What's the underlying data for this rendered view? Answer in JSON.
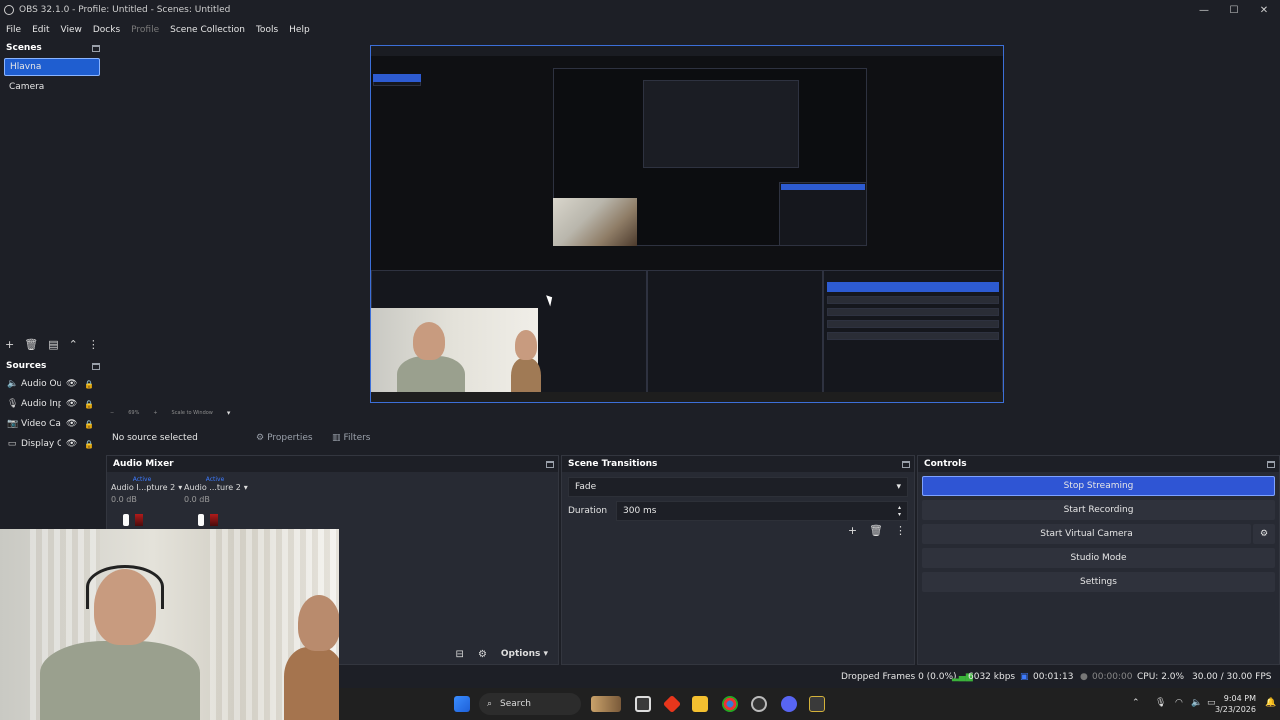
{
  "window": {
    "title": "OBS 32.1.0 - Profile: Untitled - Scenes: Untitled",
    "minimize_glyph": "—",
    "maximize_glyph": "☐",
    "close_glyph": "✕"
  },
  "menu": [
    "File",
    "Edit",
    "View",
    "Docks",
    "Profile",
    "Scene Collection",
    "Tools",
    "Help"
  ],
  "scenes": {
    "title": "Scenes",
    "items": [
      "Hlavna",
      "Camera"
    ],
    "selected": "Hlavna"
  },
  "sources": {
    "title": "Sources",
    "items": [
      {
        "label": "Audio Out",
        "icon": "speaker-icon"
      },
      {
        "label": "Audio Inp",
        "icon": "microphone-icon"
      },
      {
        "label": "Video Cap",
        "icon": "camera-icon"
      },
      {
        "label": "Display Ca",
        "icon": "monitor-icon"
      }
    ]
  },
  "context": {
    "no_source": "No source selected",
    "properties": "Properties",
    "filters": "Filters"
  },
  "preview_bottom": {
    "zoom": "69%",
    "scale": "Scale to Window"
  },
  "audio_mixer": {
    "title": "Audio Mixer",
    "tracks": [
      {
        "name": "Audio I...pture 2",
        "status": "Active",
        "db": "0.0 dB"
      },
      {
        "name": "Audio ...ture 2",
        "status": "Active",
        "db": "0.0 dB"
      }
    ],
    "options_label": "Options"
  },
  "scene_transitions": {
    "title": "Scene Transitions",
    "transition": "Fade",
    "duration_label": "Duration",
    "duration_value": "300 ms"
  },
  "controls": {
    "title": "Controls",
    "stop_streaming": "Stop Streaming",
    "start_recording": "Start Recording",
    "start_virtual_camera": "Start Virtual Camera",
    "studio_mode": "Studio Mode",
    "settings": "Settings"
  },
  "status": {
    "dropped_frames": "Dropped Frames 0 (0.0%)",
    "bitrate": "6032 kbps",
    "stream_time": "00:01:13",
    "record_time": "00:00:00",
    "cpu": "CPU: 2.0%",
    "fps": "30.00 / 30.00 FPS"
  },
  "taskbar": {
    "search": "Search",
    "time": "9:04 PM",
    "date": "3/23/2026"
  },
  "colors": {
    "accent": "#2f55d4",
    "background": "#1d1f26",
    "dock": "#272a33"
  }
}
